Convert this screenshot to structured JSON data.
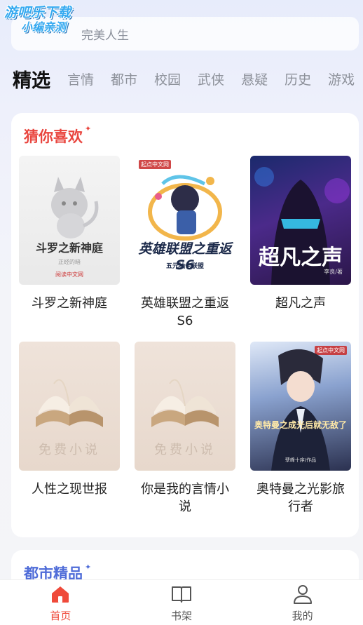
{
  "watermark": {
    "line1": "游吧乐下载",
    "line2": "小编亲测"
  },
  "search": {
    "placeholder_visible": "完美人生"
  },
  "tabs": [
    {
      "label": "精选",
      "active": true
    },
    {
      "label": "言情"
    },
    {
      "label": "都市"
    },
    {
      "label": "校园"
    },
    {
      "label": "武侠"
    },
    {
      "label": "悬疑"
    },
    {
      "label": "历史"
    },
    {
      "label": "游戏"
    }
  ],
  "section1": {
    "title": "猜你喜欢",
    "books": [
      {
        "title": "斗罗之新神庭",
        "cover_title": "斗罗之新神庭",
        "cover_author": "正经的暗",
        "cover_brand": "阅读中文网"
      },
      {
        "title": "英雄联盟之重返S6",
        "cover_title": "英雄联盟之重返S6",
        "cover_subtitle": "五元抽卡联盟",
        "cover_brand": "起点中文网"
      },
      {
        "title": "超凡之声",
        "cover_title": "超凡之声",
        "cover_author": "李良/著"
      },
      {
        "title": "人性之现世报",
        "cover_title": "免费小说"
      },
      {
        "title": "你是我的言情小说",
        "cover_title": "免费小说"
      },
      {
        "title": "奥特曼之光影旅行者",
        "cover_title": "奥特曼之成光后就无敌了",
        "cover_author": "孽峰十序/作品",
        "cover_brand": "起点中文网"
      }
    ]
  },
  "section2": {
    "title": "都市精品"
  },
  "nav": [
    {
      "label": "首页",
      "icon": "home-icon",
      "active": true
    },
    {
      "label": "书架",
      "icon": "book-icon"
    },
    {
      "label": "我的",
      "icon": "user-icon"
    }
  ],
  "colors": {
    "accent": "#ef4a3a",
    "section1_title": "#e9463f",
    "section2_title": "#4f6cd8"
  }
}
